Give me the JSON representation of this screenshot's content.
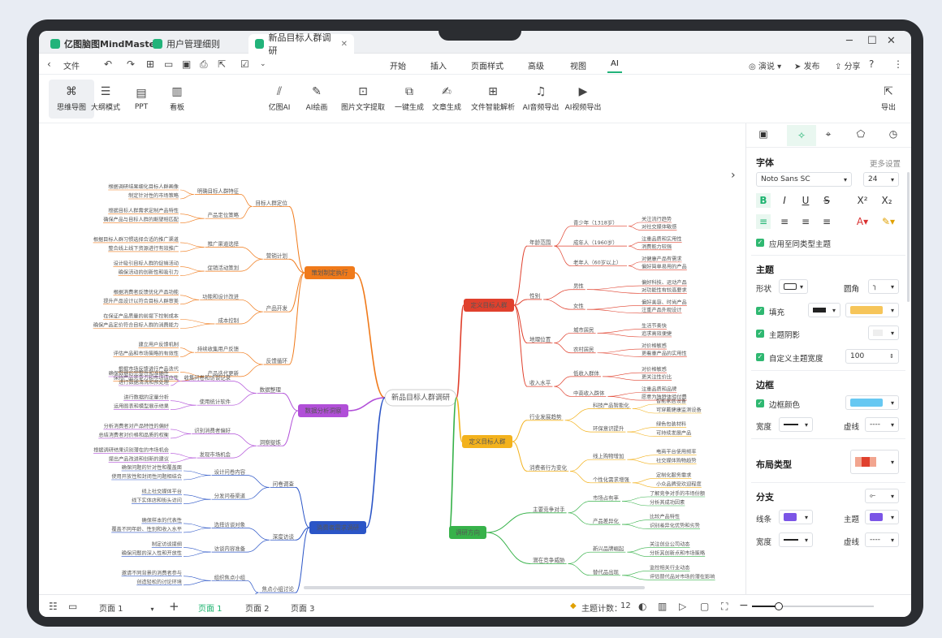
{
  "window": {
    "app_name": "亿图脑图MindMaster",
    "tabs": [
      {
        "label": "用户管理细则"
      },
      {
        "label": "新品目标人群调研"
      }
    ],
    "controls": {
      "minimize": "─",
      "maximize": "☐",
      "close": "✕"
    }
  },
  "toolbar": {
    "file_label": "文件",
    "menu": [
      "开始",
      "插入",
      "页面样式",
      "高级",
      "视图",
      "AI"
    ],
    "active_menu": "AI",
    "present_label": "演说",
    "publish_label": "发布",
    "share_label": "分享"
  },
  "ribbon": {
    "modes": [
      {
        "label": "思维导图",
        "icon": "mindmap-icon"
      },
      {
        "label": "大纲模式",
        "icon": "outline-icon"
      },
      {
        "label": "PPT",
        "icon": "ppt-icon"
      },
      {
        "label": "看板",
        "icon": "kanban-icon"
      }
    ],
    "ai_tools": [
      {
        "label": "亿图AI",
        "icon": "ai-icon"
      },
      {
        "label": "AI绘画",
        "icon": "paint-icon"
      },
      {
        "label": "图片文字提取",
        "icon": "ocr-icon"
      },
      {
        "label": "一键生成",
        "icon": "generate-icon"
      },
      {
        "label": "文章生成",
        "icon": "article-icon"
      },
      {
        "label": "文件智能解析",
        "icon": "parse-icon"
      },
      {
        "label": "AI音频导出",
        "icon": "audio-icon"
      },
      {
        "label": "AI视频导出",
        "icon": "video-icon"
      }
    ],
    "export_label": "导出"
  },
  "mindmap": {
    "root": "新品目标人群调研",
    "branches": [
      {
        "label": "策划制定执行",
        "color": "#f07a1a"
      },
      {
        "label": "数据分析洞察",
        "color": "#b14fd8"
      },
      {
        "label": "消费者需求调研",
        "color": "#2b55c7"
      },
      {
        "label": "定义目标人群",
        "color": "#e0402d"
      },
      {
        "label": "定义目标人群",
        "color": "#f3b21d"
      },
      {
        "label": "调研方向",
        "color": "#37b24a"
      }
    ],
    "left_top": {
      "subs": [
        {
          "label": "目标人群定位",
          "children": [
            {
              "label": "明确目标人群特征",
              "leaves": [
                "根据调研结果细化目标人群画像",
                "制定针对性的市场策略"
              ]
            },
            {
              "label": "产品定位策略",
              "leaves": [
                "根据目标人群需求定制产品特性",
                "确保产品与目标人群的期望相匹配"
              ]
            }
          ]
        },
        {
          "label": "营销计划",
          "children": [
            {
              "label": "推广渠道选择",
              "leaves": [
                "根据目标人群习惯选择合适的推广渠道",
                "整合线上线下资源进行有效推广"
              ]
            },
            {
              "label": "促销活动策划",
              "leaves": [
                "设计吸引目标人群的促销活动",
                "确保活动的创新性和吸引力"
              ]
            }
          ]
        },
        {
          "label": "产品开发",
          "children": [
            {
              "label": "功能和设计改进",
              "leaves": [
                "根据消费者反馈优化产品功能",
                "提升产品设计以符合目标人群审美"
              ]
            },
            {
              "label": "成本控制",
              "leaves": [
                "在保证产品质量的前提下控制成本",
                "确保产品定价符合目标人群的消费能力"
              ]
            }
          ]
        },
        {
          "label": "反馈循环",
          "children": [
            {
              "label": "持续收集用户反馈",
              "leaves": [
                "建立用户反馈机制",
                "评估产品和市场策略的有效性"
              ]
            },
            {
              "label": "产品迭代更新",
              "leaves": [
                "根据市场反馈进行产品迭代",
                "保持产品竞争力和市场适应性"
              ]
            }
          ]
        }
      ]
    },
    "left_mid": {
      "subs": [
        {
          "label": "数据整理",
          "children": [
            {
              "label": "收集问卷和访谈记录",
              "leaves": [
                "确保数据的完整性和准确性",
                "进行数据清洗和预处理"
              ]
            },
            {
              "label": "使用统计软件",
              "leaves": [
                "进行数据的定量分析",
                "运用图表和模型展示结果"
              ]
            }
          ]
        },
        {
          "label": "洞察提炼",
          "children": [
            {
              "label": "识别消费者偏好",
              "leaves": [
                "分析消费者对产品特性的偏好",
                "总结消费者对价格和品质的权衡"
              ]
            },
            {
              "label": "发现市场机会",
              "leaves": [
                "根据调研结果识别潜在的市场机会",
                "提出产品改进和创新的建议"
              ]
            }
          ]
        }
      ]
    },
    "left_bottom": {
      "subs": [
        {
          "label": "问卷调查",
          "children": [
            {
              "label": "设计问卷内容",
              "leaves": [
                "确保问题的针对性和覆盖面",
                "使用开放性和封闭性问题相结合"
              ]
            },
            {
              "label": "分发问卷渠道",
              "leaves": [
                "线上社交媒体平台",
                "线下实体店和街头访问"
              ]
            }
          ]
        },
        {
          "label": "深度访谈",
          "children": [
            {
              "label": "选择访谈对象",
              "leaves": [
                "确保样本的代表性",
                "覆盖不同年龄、性别和收入水平"
              ]
            },
            {
              "label": "访谈内容准备",
              "leaves": [
                "制定访谈提纲",
                "确保问题的深入性和开放性"
              ]
            }
          ]
        },
        {
          "label": "焦点小组讨论",
          "children": [
            {
              "label": "组织焦点小组",
              "leaves": [
                "邀请不同背景的消费者参与",
                "创造轻松的讨论环境"
              ]
            },
            {
              "label": "讨论主题设定",
              "leaves": [
                "围绕产品使用体验",
                "探讨消费者对新品的期望和建议"
              ]
            }
          ]
        }
      ]
    },
    "right_top": {
      "subs": [
        {
          "label": "年龄范围",
          "children": [
            {
              "label": "青少年（1318岁）",
              "leaves": [
                "关注流行趋势",
                "对社交媒体敏感"
              ]
            },
            {
              "label": "成年人（1960岁）",
              "leaves": [
                "注重品质和实用性",
                "消费能力较强"
              ]
            },
            {
              "label": "老年人（60岁以上）",
              "leaves": [
                "对健康产品有需求",
                "偏好简单易用的产品"
              ]
            }
          ]
        },
        {
          "label": "性别",
          "children": [
            {
              "label": "男性",
              "leaves": [
                "偏好科技、运动产品",
                "对功能性有较高要求"
              ]
            },
            {
              "label": "女性",
              "leaves": [
                "偏好美容、时尚产品",
                "注重产品外观设计"
              ]
            }
          ]
        },
        {
          "label": "地理位置",
          "children": [
            {
              "label": "城市居民",
              "leaves": [
                "生活节奏快",
                "追求高效便捷"
              ]
            },
            {
              "label": "农村居民",
              "leaves": [
                "对价格敏感",
                "更看重产品的实用性"
              ]
            }
          ]
        },
        {
          "label": "收入水平",
          "children": [
            {
              "label": "低收入群体",
              "leaves": [
                "对价格敏感",
                "更关注性价比"
              ]
            },
            {
              "label": "中高收入群体",
              "leaves": [
                "注重品质和品牌",
                "愿意为独特体验付费"
              ]
            }
          ]
        }
      ]
    },
    "right_mid": {
      "subs": [
        {
          "label": "行业发展趋势",
          "children": [
            {
              "label": "科技产品智能化",
              "leaves": [
                "智能家居设备",
                "可穿戴健康监测设备"
              ]
            },
            {
              "label": "环保意识提升",
              "leaves": [
                "绿色包装材料",
                "可持续发展产品"
              ]
            }
          ]
        },
        {
          "label": "消费者行为变化",
          "children": [
            {
              "label": "线上购物增加",
              "leaves": [
                "电商平台使用频率",
                "社交媒体购物趋势"
              ]
            },
            {
              "label": "个性化需求增强",
              "leaves": [
                "定制化服务需求",
                "小众品牌受欢迎程度"
              ]
            }
          ]
        }
      ]
    },
    "right_bottom": {
      "subs": [
        {
          "label": "主要竞争对手",
          "children": [
            {
              "label": "市场占有率",
              "leaves": [
                "了解竞争对手的市场份额",
                "分析其成功因素"
              ]
            },
            {
              "label": "产品差异化",
              "leaves": [
                "比较产品特性",
                "识别差异化优势和劣势"
              ]
            }
          ]
        },
        {
          "label": "潜在竞争威胁",
          "children": [
            {
              "label": "新兴品牌崛起",
              "leaves": [
                "关注创业公司动态",
                "分析其创新点和市场策略"
              ]
            },
            {
              "label": "替代品出现",
              "leaves": [
                "监控相关行业动态",
                "评估替代品对市场的潜在影响"
              ]
            }
          ]
        }
      ]
    }
  },
  "panel": {
    "tabs": [
      {
        "icon": "style-icon"
      },
      {
        "icon": "ai-sparkle-icon"
      },
      {
        "icon": "location-icon"
      },
      {
        "icon": "theme-icon"
      },
      {
        "icon": "clock-icon"
      }
    ],
    "font": {
      "heading": "字体",
      "more": "更多设置",
      "family": "Noto Sans SC",
      "size": "24",
      "apply_same": "应用至同类型主题"
    },
    "topic": {
      "heading": "主题",
      "shape_label": "形状",
      "corner_label": "圆角",
      "fill_label": "填充",
      "fill_color": "#f6c55a",
      "shadow_label": "主题阴影",
      "custom_width_label": "自定义主题宽度",
      "custom_width_value": "100"
    },
    "border": {
      "heading": "边框",
      "color_label": "边框颜色",
      "color": "#67c8f2",
      "width_label": "宽度",
      "dash_label": "虚线",
      "dash_value": "----"
    },
    "layout": {
      "heading": "布局类型"
    },
    "branch": {
      "heading": "分支",
      "line_label": "线条",
      "line_color": "#7b55e6",
      "topic_label": "主题",
      "topic_color": "#7b55e6",
      "width_label": "宽度",
      "dash_label": "虚线",
      "dash_value": "----"
    }
  },
  "statusbar": {
    "page_select": "页面 1",
    "pages": [
      "页面 1",
      "页面 2",
      "页面 3"
    ],
    "topic_count_label": "主题计数：",
    "topic_count": "12",
    "zoom_fraction": 0.22
  }
}
